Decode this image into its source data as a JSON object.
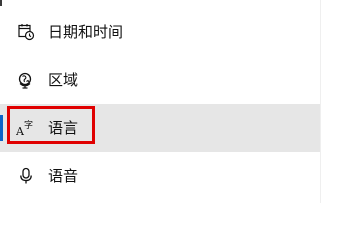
{
  "nav": {
    "items": [
      {
        "label": "日期和时间",
        "icon": "calendar-clock-icon"
      },
      {
        "label": "区域",
        "icon": "region-globe-icon"
      },
      {
        "label": "语言",
        "icon": "language-icon",
        "selected": true
      },
      {
        "label": "语音",
        "icon": "microphone-icon"
      }
    ]
  },
  "colors": {
    "selected_background": "#e6e6e6",
    "selection_indicator": "#0a64c8",
    "highlight_box": "#e00000",
    "text": "#111111"
  }
}
